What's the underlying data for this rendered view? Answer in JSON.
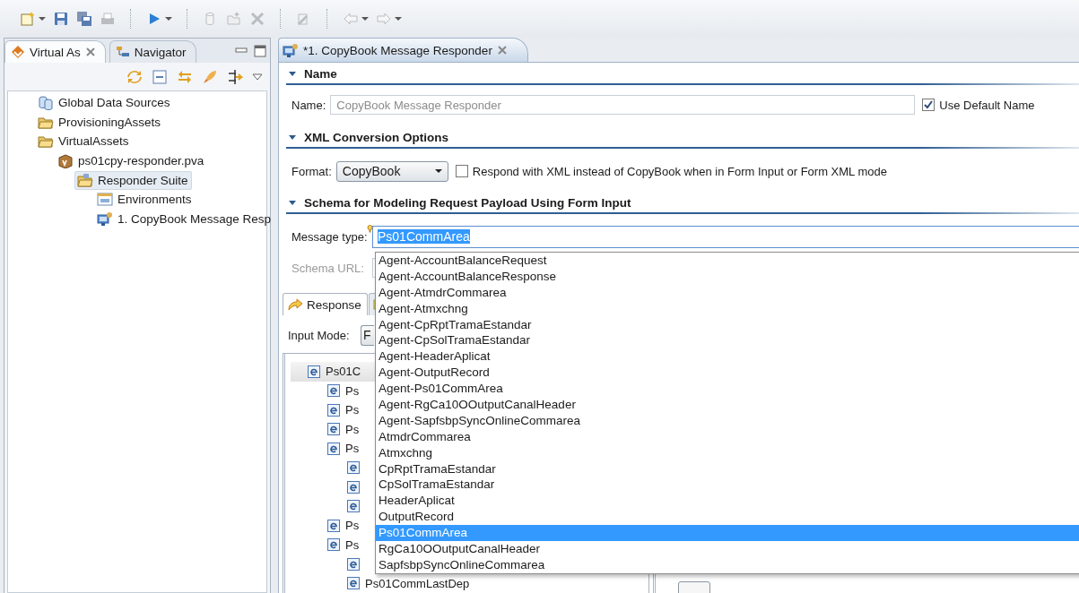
{
  "toolbar": [
    {
      "kind": "new",
      "disabled": false,
      "dropdown": true
    },
    {
      "kind": "save",
      "disabled": false
    },
    {
      "kind": "save_all",
      "disabled": false
    },
    {
      "kind": "print",
      "disabled": true
    },
    {
      "kind": "separator"
    },
    {
      "kind": "run",
      "disabled": false,
      "dropdown": true
    },
    {
      "kind": "separator"
    },
    {
      "kind": "cylinder",
      "disabled": true
    },
    {
      "kind": "open_folder",
      "disabled": true
    },
    {
      "kind": "tools",
      "disabled": true
    },
    {
      "kind": "separator"
    },
    {
      "kind": "wand",
      "disabled": true
    },
    {
      "kind": "separator"
    },
    {
      "kind": "back",
      "disabled": true,
      "dropdown": true
    },
    {
      "kind": "forward",
      "disabled": true,
      "dropdown": true
    }
  ],
  "left_panel": {
    "tabs": [
      {
        "label": "Virtual As",
        "selected": true
      },
      {
        "label": "Navigator",
        "selected": false
      }
    ],
    "tree": [
      {
        "label": "Global Data Sources",
        "kind": "datasource",
        "selected": false
      },
      {
        "label": "ProvisioningAssets",
        "kind": "folder",
        "selected": false
      },
      {
        "label": "VirtualAssets",
        "kind": "folder",
        "selected": false,
        "children": [
          {
            "label": "ps01cpy-responder.pva",
            "kind": "package",
            "selected": false,
            "children": [
              {
                "label": "Responder Suite",
                "kind": "suite",
                "selected": true,
                "children": [
                  {
                    "label": "Environments",
                    "kind": "environments",
                    "selected": false
                  },
                  {
                    "label": "1. CopyBook Message Resp",
                    "kind": "responder",
                    "selected": false
                  }
                ]
              }
            ]
          }
        ]
      }
    ]
  },
  "editor": {
    "tab": {
      "label": "*1. CopyBook Message Responder",
      "selected": true
    },
    "sections": [
      {
        "title": "Name",
        "expanded": true
      },
      {
        "title": "XML Conversion Options",
        "expanded": true
      },
      {
        "title": "Schema for Modeling Request Payload Using Form Input",
        "expanded": true
      }
    ],
    "name_field": {
      "label": "Name:",
      "value": "CopyBook Message Responder",
      "disabled": true
    },
    "use_default_name": {
      "label": "Use Default Name",
      "checked": true
    },
    "format": {
      "label": "Format:",
      "value": "CopyBook"
    },
    "respond_with_xml": {
      "label": "Respond with XML instead of CopyBook when in Form Input or Form XML mode",
      "checked": false
    },
    "message_type": {
      "label": "Message type:",
      "value": "Ps01CommArea"
    },
    "schema_url": {
      "label": "Schema URL:",
      "disabled": true
    },
    "payload_tabs": [
      {
        "label": "Response",
        "selected": true
      },
      {
        "selected": false
      }
    ],
    "input_mode": {
      "label": "Input Mode:",
      "value": "F"
    },
    "element_tree": [
      {
        "label": "Ps01C",
        "selected": true,
        "children": [
          {
            "label": "Ps",
            "selected": false
          },
          {
            "label": "Ps",
            "selected": false
          },
          {
            "label": "Ps",
            "selected": false
          },
          {
            "label": "Ps",
            "selected": false,
            "children": [
              {
                "selected": false
              },
              {
                "selected": false
              },
              {
                "selected": false
              }
            ]
          },
          {
            "label": "Ps",
            "selected": false
          },
          {
            "label": "Ps",
            "selected": false,
            "children": [
              {
                "selected": false
              },
              {
                "label": "Ps01CommLastDep",
                "selected": false
              }
            ]
          }
        ]
      }
    ],
    "message_type_dropdown": [
      {
        "label": "Agent-AccountBalanceRequest",
        "selected": false
      },
      {
        "label": "Agent-AccountBalanceResponse",
        "selected": false
      },
      {
        "label": "Agent-AtmdrCommarea",
        "selected": false
      },
      {
        "label": "Agent-Atmxchng",
        "selected": false
      },
      {
        "label": "Agent-CpRptTramaEstandar",
        "selected": false
      },
      {
        "label": "Agent-CpSolTramaEstandar",
        "selected": false
      },
      {
        "label": "Agent-HeaderAplicat",
        "selected": false
      },
      {
        "label": "Agent-OutputRecord",
        "selected": false
      },
      {
        "label": "Agent-Ps01CommArea",
        "selected": false
      },
      {
        "label": "Agent-RgCa10OOutputCanalHeader",
        "selected": false
      },
      {
        "label": "Agent-SapfsbpSyncOnlineCommarea",
        "selected": false
      },
      {
        "label": "AtmdrCommarea",
        "selected": false
      },
      {
        "label": "Atmxchng",
        "selected": false
      },
      {
        "label": "CpRptTramaEstandar",
        "selected": false
      },
      {
        "label": "CpSolTramaEstandar",
        "selected": false
      },
      {
        "label": "HeaderAplicat",
        "selected": false
      },
      {
        "label": "OutputRecord",
        "selected": false
      },
      {
        "label": "Ps01CommArea",
        "selected": true
      },
      {
        "label": "RgCa10OOutputCanalHeader",
        "selected": false
      },
      {
        "label": "SapfsbpSyncOnlineCommarea",
        "selected": false
      }
    ]
  }
}
